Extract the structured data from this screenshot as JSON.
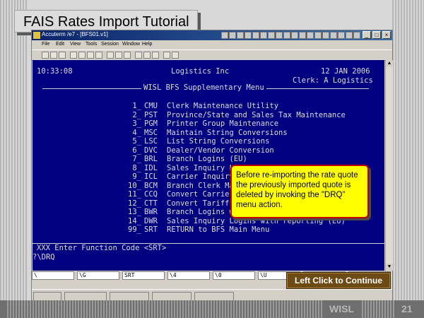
{
  "slide": {
    "title": "FAIS Rates Import Tutorial",
    "footer_label": "WISL",
    "page_number": "21",
    "continue_label": "Left Click to Continue",
    "callout_text": "Before re-importing the rate quote the previously imported quote is deleted by invoking the \"DRQ\" menu action."
  },
  "window": {
    "title_text": "Accuterm /e7 - [BFS01.v1]",
    "menus": [
      "File",
      "Edit",
      "View",
      "Tools",
      "Session",
      "Window",
      "Help"
    ]
  },
  "terminal": {
    "time": "10:33:08",
    "company": "Logistics Inc",
    "date": "12 JAN 2006",
    "clerk": "Clerk: A Logistics",
    "menu_title": "WISL BFS Supplementary Menu",
    "items": [
      {
        "num": "1_",
        "code": "CMU",
        "label": "Clerk Maintenance Utility"
      },
      {
        "num": "2_",
        "code": "PST",
        "label": "Province/State and Sales Tax Maintenance"
      },
      {
        "num": "3_",
        "code": "PGM",
        "label": "Printer Group Maintenance"
      },
      {
        "num": "4_",
        "code": "MSC",
        "label": "Maintain String Conversions"
      },
      {
        "num": "5_",
        "code": "LSC",
        "label": "List String Conversions"
      },
      {
        "num": "6_",
        "code": "DVC",
        "label": "Dealer/Vendor Conversion"
      },
      {
        "num": "7_",
        "code": "BRL",
        "label": "Branch Logins (EU)"
      },
      {
        "num": "8_",
        "code": "IDL",
        "label": "Sales Inquiry Lo"
      },
      {
        "num": "9_",
        "code": "ICL",
        "label": "Carrier Inquiry"
      },
      {
        "num": "10_",
        "code": "BCM",
        "label": "Branch Clerk Mai"
      },
      {
        "num": "11_",
        "code": "CCQ",
        "label": "Convert Carrier"
      },
      {
        "num": "12_",
        "code": "CTT",
        "label": "Convert Tariff D"
      },
      {
        "num": "13_",
        "code": "BWR",
        "label": "Branch Logins wi"
      },
      {
        "num": "14_",
        "code": "DWR",
        "label": "Sales Inquiry Logins with reporting (EU)"
      },
      {
        "num": "99_",
        "code": "SRT",
        "label": "RETURN to BFS Main Menu"
      }
    ],
    "prompt": "XXX Enter Function Code <SRT>",
    "input_line": "?\\DRQ"
  },
  "function_keys": [
    "\\",
    "\\G",
    "SRT",
    "\\4",
    "\\0",
    "\\U",
    "",
    ""
  ],
  "colors": {
    "terminal_bg": "#000080",
    "terminal_fg": "#dcdcdc",
    "callout_bg": "#ffff00",
    "callout_border": "#c00000",
    "continue_bg": "#6e4a14"
  }
}
